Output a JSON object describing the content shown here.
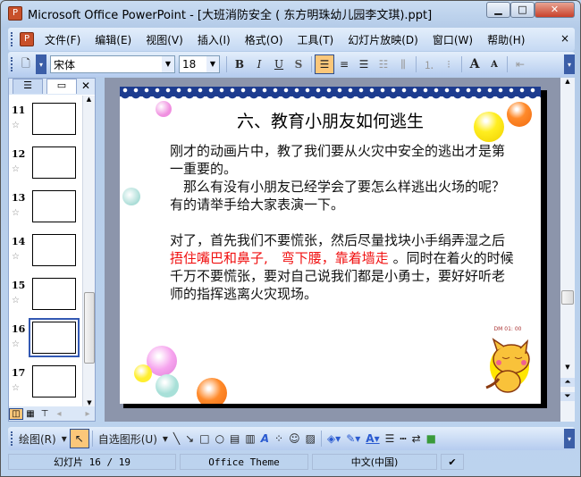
{
  "window": {
    "title": "Microsoft Office PowerPoint - [大班消防安全 ( 东方明珠幼儿园李文琪).ppt]",
    "minimize": "▁",
    "maximize": "□",
    "close": "✕"
  },
  "menu": {
    "items": [
      "文件(F)",
      "编辑(E)",
      "视图(V)",
      "插入(I)",
      "格式(O)",
      "工具(T)",
      "幻灯片放映(D)",
      "窗口(W)",
      "帮助(H)"
    ],
    "close": "×"
  },
  "toolbar": {
    "font": "宋体",
    "size": "18",
    "bold": "B",
    "italic": "I",
    "underline": "U",
    "shadow": "S",
    "inc_font": "A",
    "dec_font": "A"
  },
  "panel": {
    "outline_tab": "☰",
    "slides_tab": "▭",
    "close": "✕",
    "thumbnails": [
      {
        "num": "11"
      },
      {
        "num": "12"
      },
      {
        "num": "13"
      },
      {
        "num": "14"
      },
      {
        "num": "15"
      },
      {
        "num": "16"
      },
      {
        "num": "17"
      }
    ]
  },
  "slide": {
    "title": "六、教育小朋友如何逃生",
    "p1": "刚才的动画片中，教了我们要从火灾中安全的逃出才是第一重要的。",
    "p2": "　那么有没有小朋友已经学会了要怎么样逃出火场的呢？有的请举手给大家表演一下。",
    "p3a": "对了，首先我们不要慌张，然后尽量找块小手绢弄湿之后",
    "p3red1": "捂住嘴巴和鼻子,",
    "p3red2": "　弯下腰，靠着墙走",
    "p3b": " 。同时在着火的时候千万不要慌张，要对自己说我们都是小勇士，要好好听老师的指挥逃离火灾现场。",
    "cat_caption": "DM 01: 00"
  },
  "drawing": {
    "draw": "绘图(R)",
    "autoshapes": "自选图形(U)"
  },
  "status": {
    "slide": "幻灯片 16 / 19",
    "theme": "Office Theme",
    "language": "中文(中国)"
  },
  "colors": {
    "accent_red": "#f01010",
    "slide_bg": "#8c95ab"
  }
}
